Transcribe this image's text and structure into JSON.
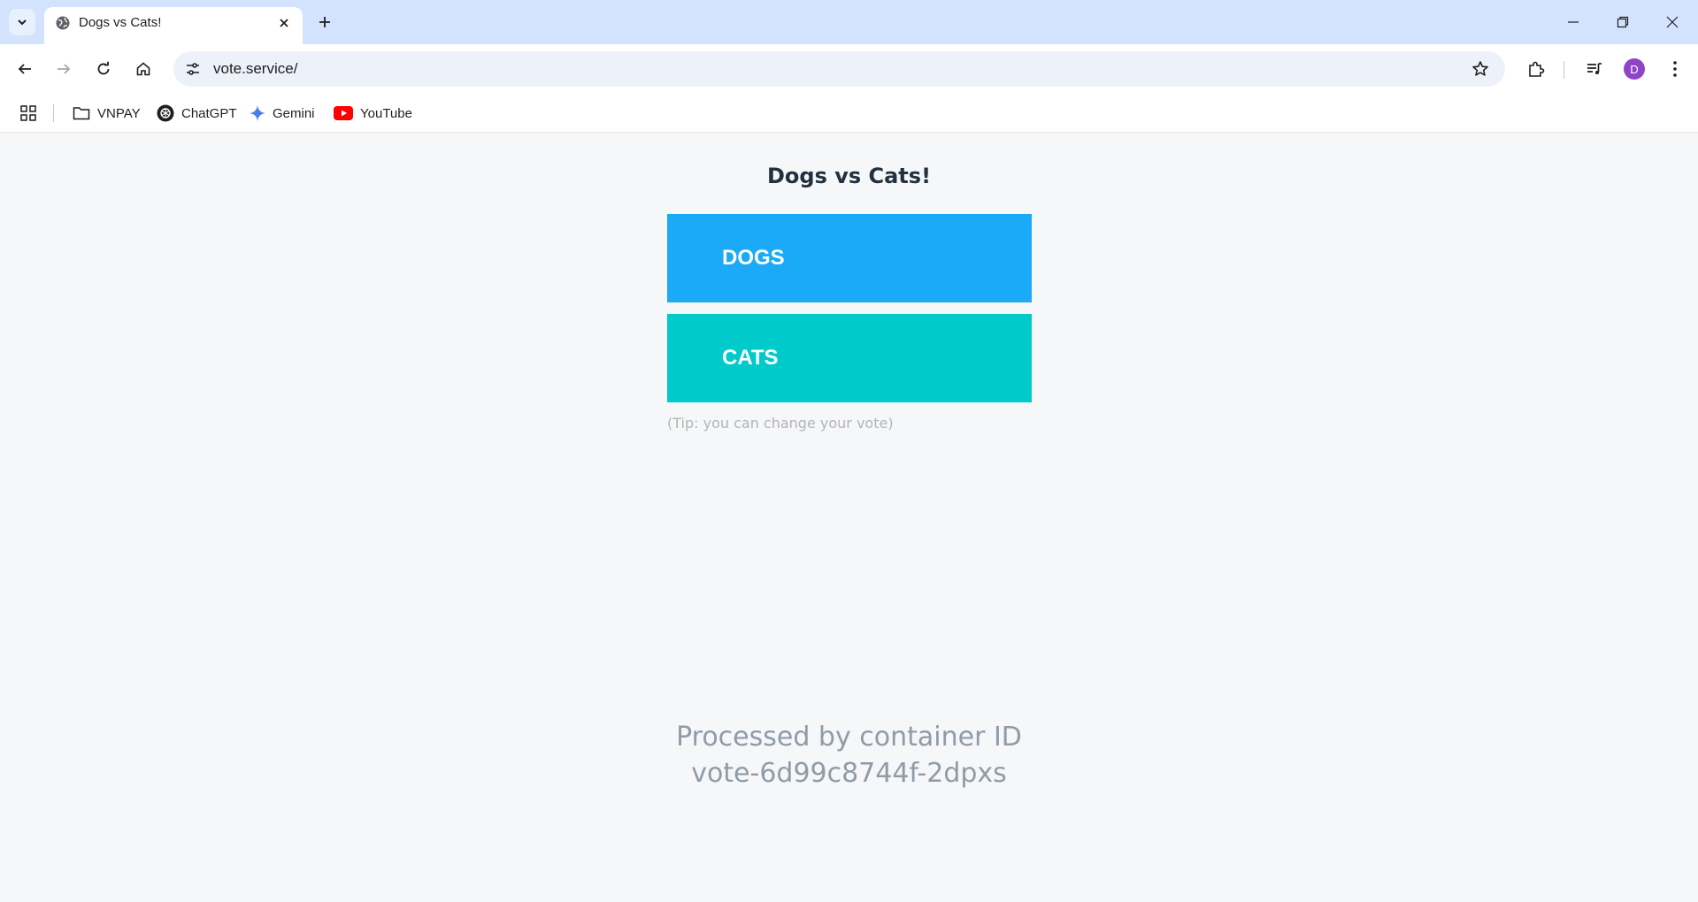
{
  "browser": {
    "tab": {
      "title": "Dogs vs Cats!"
    },
    "url": "vote.service/",
    "profile_initial": "D",
    "bookmarks": [
      {
        "label": "VNPAY",
        "icon": "folder-icon"
      },
      {
        "label": "ChatGPT",
        "icon": "chatgpt-icon"
      },
      {
        "label": "Gemini",
        "icon": "gemini-icon"
      },
      {
        "label": "YouTube",
        "icon": "youtube-icon"
      }
    ]
  },
  "page": {
    "title": "Dogs vs Cats!",
    "option_a": "DOGS",
    "option_b": "CATS",
    "tip": "(Tip: you can change your vote)",
    "processed_line1": "Processed by container ID",
    "processed_line2": "vote-6d99c8744f-2dpxs"
  },
  "colors": {
    "dogs_button": "#1aaaf8",
    "cats_button": "#00cbca",
    "title_text": "#22313f",
    "tabstrip": "#d3e3fd"
  }
}
